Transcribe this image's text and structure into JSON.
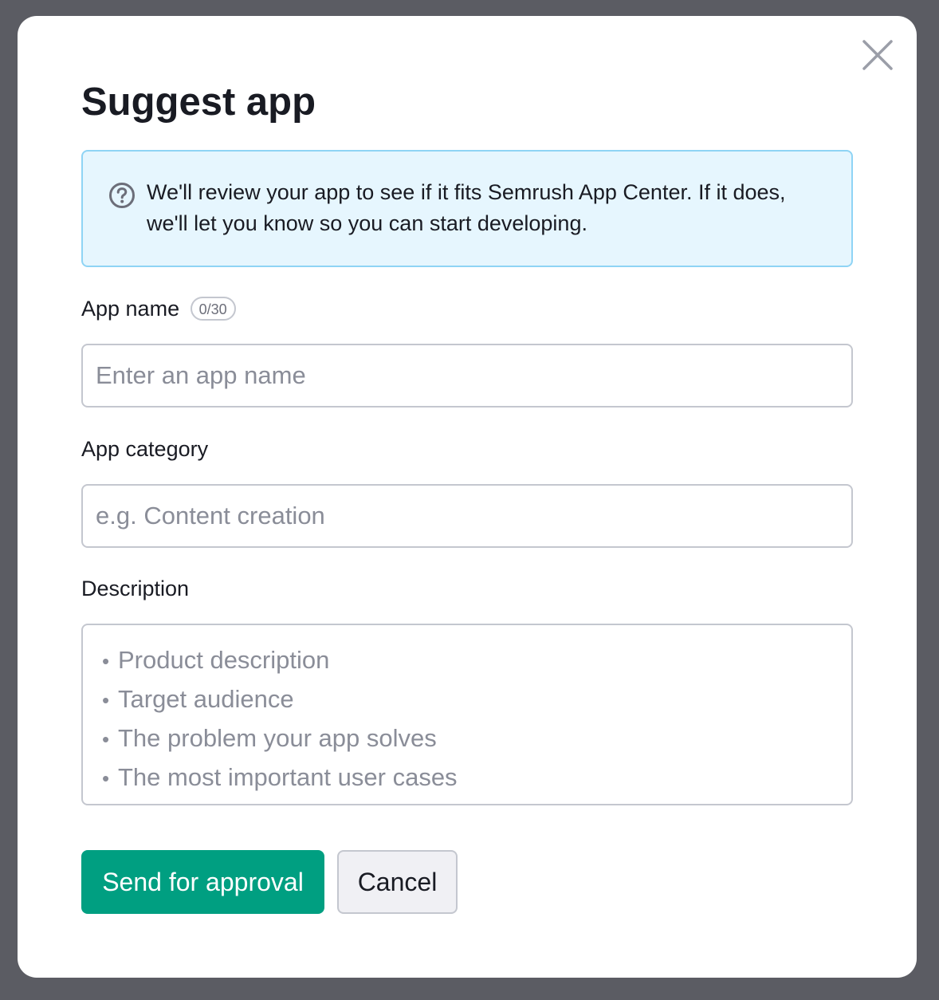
{
  "modal": {
    "title": "Suggest app",
    "close_icon": "close-icon"
  },
  "notice": {
    "icon": "question-circle-icon",
    "text": "We'll review your app to see if it fits Semrush App Center. If it does, we'll let you know so you can start developing."
  },
  "form": {
    "app_name": {
      "label": "App name",
      "counter": "0/30",
      "value": "",
      "placeholder": "Enter an app name"
    },
    "app_category": {
      "label": "App category",
      "value": "",
      "placeholder": "e.g. Content creation"
    },
    "description": {
      "label": "Description",
      "value": "",
      "placeholder_lines": [
        "Product description",
        "Target audience",
        "The problem your app solves",
        "The most important user cases"
      ]
    }
  },
  "actions": {
    "submit_label": "Send for approval",
    "cancel_label": "Cancel"
  },
  "colors": {
    "overlay": "#5b5c63",
    "primary": "#009f81",
    "notice_bg": "#e6f6fe",
    "notice_border": "#8fd4f5"
  }
}
